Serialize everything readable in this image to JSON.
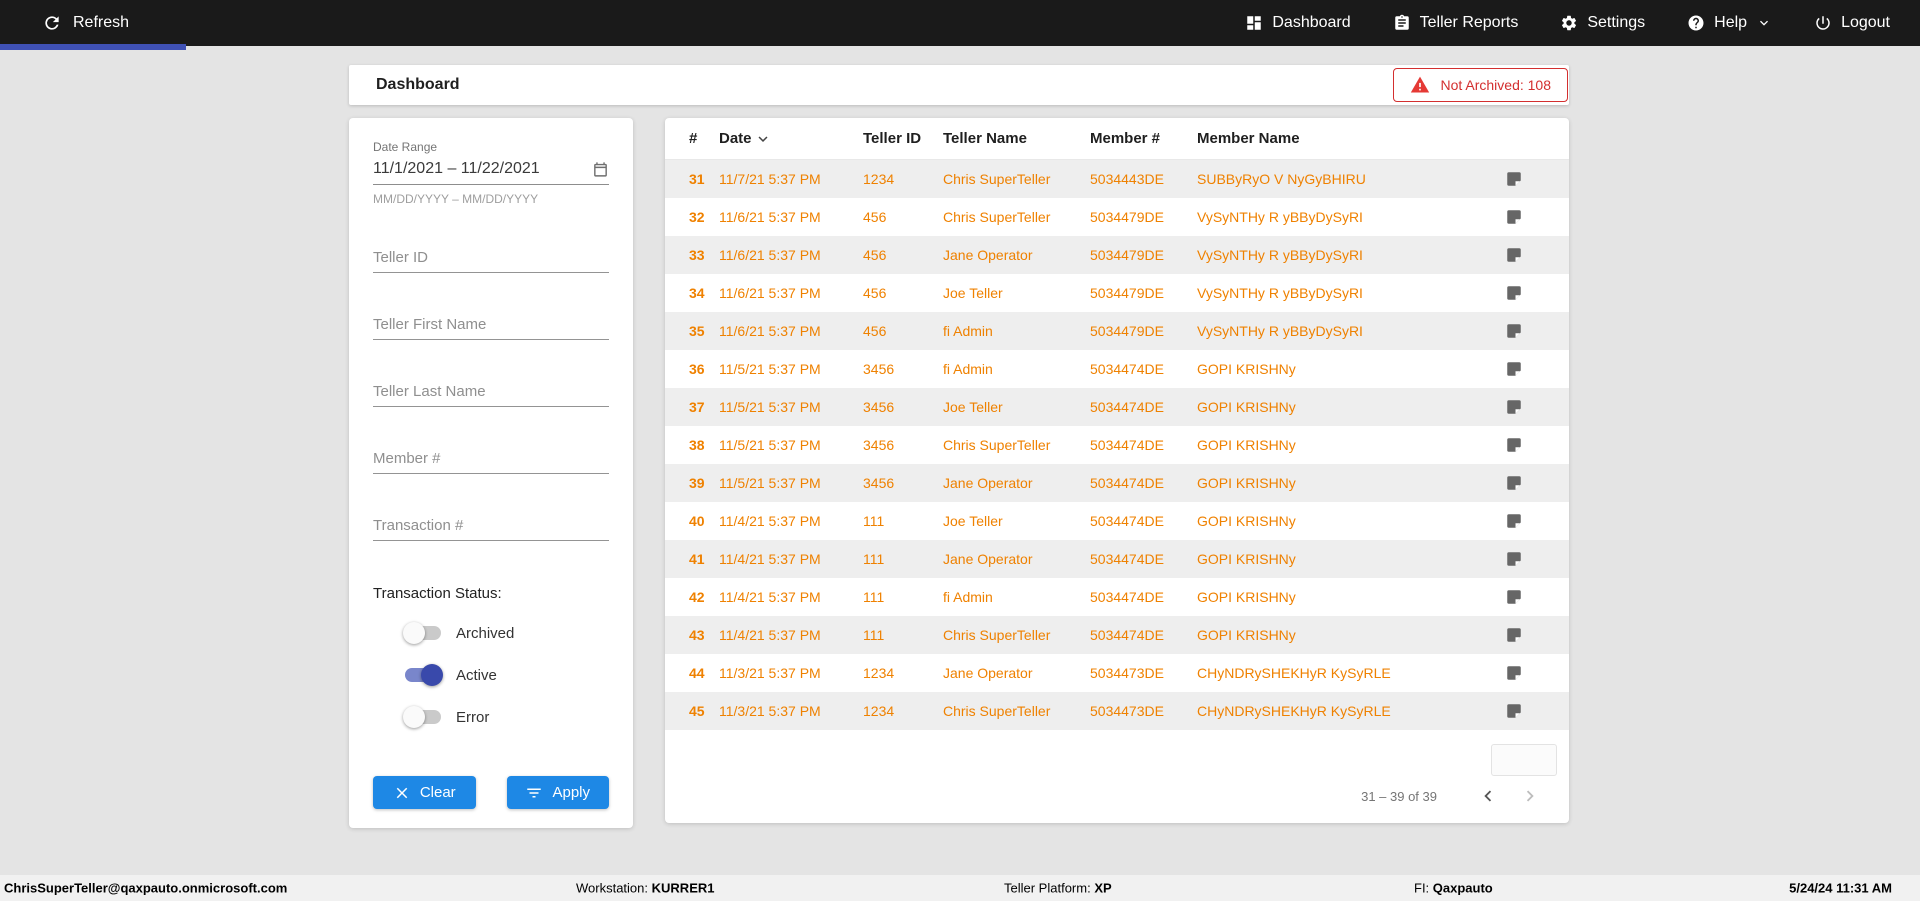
{
  "topbar": {
    "refresh_label": "Refresh",
    "nav": [
      {
        "label": "Dashboard",
        "icon": "dashboard-icon"
      },
      {
        "label": "Teller Reports",
        "icon": "clipboard-icon"
      },
      {
        "label": "Settings",
        "icon": "gear-icon"
      },
      {
        "label": "Help",
        "icon": "help-icon",
        "chevron": "chevron-down-icon"
      },
      {
        "label": "Logout",
        "icon": "power-icon"
      }
    ]
  },
  "header": {
    "title": "Dashboard",
    "not_archived": {
      "label": "Not Archived: 108",
      "icon": "warning-triangle-icon"
    }
  },
  "filters": {
    "date_range_label": "Date Range",
    "date_range_value": "11/1/2021 – 11/22/2021",
    "date_range_hint": "MM/DD/YYYY – MM/DD/YYYY",
    "date_icon": "calendar-icon",
    "fields": [
      {
        "placeholder": "Teller ID"
      },
      {
        "placeholder": "Teller First Name"
      },
      {
        "placeholder": "Teller Last Name"
      },
      {
        "placeholder": "Member #"
      },
      {
        "placeholder": "Transaction #"
      }
    ],
    "status_label": "Transaction Status:",
    "toggles": [
      {
        "label": "Archived",
        "on": false
      },
      {
        "label": "Active",
        "on": true
      },
      {
        "label": "Error",
        "on": false
      }
    ],
    "clear_label": "Clear",
    "clear_icon": "close-icon",
    "apply_label": "Apply",
    "apply_icon": "filter-icon"
  },
  "table": {
    "columns": [
      "#",
      "Date",
      "Teller ID",
      "Teller Name",
      "Member #",
      "Member Name"
    ],
    "sorted_by": "Date",
    "sort_direction": "desc",
    "row_note_icon": "note-icon",
    "rows": [
      {
        "num": "31",
        "date": "11/7/21 5:37 PM",
        "teller_id": "1234",
        "teller_name": "Chris SuperTeller",
        "member_num": "5034443DE",
        "member_name": "SUBByRyO V NyGyBHIRU"
      },
      {
        "num": "32",
        "date": "11/6/21 5:37 PM",
        "teller_id": "456",
        "teller_name": "Chris SuperTeller",
        "member_num": "5034479DE",
        "member_name": "VySyNTHy R yBByDySyRI"
      },
      {
        "num": "33",
        "date": "11/6/21 5:37 PM",
        "teller_id": "456",
        "teller_name": "Jane Operator",
        "member_num": "5034479DE",
        "member_name": "VySyNTHy R yBByDySyRI"
      },
      {
        "num": "34",
        "date": "11/6/21 5:37 PM",
        "teller_id": "456",
        "teller_name": "Joe Teller",
        "member_num": "5034479DE",
        "member_name": "VySyNTHy R yBByDySyRI"
      },
      {
        "num": "35",
        "date": "11/6/21 5:37 PM",
        "teller_id": "456",
        "teller_name": "fi Admin",
        "member_num": "5034479DE",
        "member_name": "VySyNTHy R yBByDySyRI"
      },
      {
        "num": "36",
        "date": "11/5/21 5:37 PM",
        "teller_id": "3456",
        "teller_name": "fi Admin",
        "member_num": "5034474DE",
        "member_name": "GOPI KRISHNy"
      },
      {
        "num": "37",
        "date": "11/5/21 5:37 PM",
        "teller_id": "3456",
        "teller_name": "Joe Teller",
        "member_num": "5034474DE",
        "member_name": "GOPI KRISHNy"
      },
      {
        "num": "38",
        "date": "11/5/21 5:37 PM",
        "teller_id": "3456",
        "teller_name": "Chris SuperTeller",
        "member_num": "5034474DE",
        "member_name": "GOPI KRISHNy"
      },
      {
        "num": "39",
        "date": "11/5/21 5:37 PM",
        "teller_id": "3456",
        "teller_name": "Jane Operator",
        "member_num": "5034474DE",
        "member_name": "GOPI KRISHNy"
      },
      {
        "num": "40",
        "date": "11/4/21 5:37 PM",
        "teller_id": "111",
        "teller_name": "Joe Teller",
        "member_num": "5034474DE",
        "member_name": "GOPI KRISHNy"
      },
      {
        "num": "41",
        "date": "11/4/21 5:37 PM",
        "teller_id": "111",
        "teller_name": "Jane Operator",
        "member_num": "5034474DE",
        "member_name": "GOPI KRISHNy"
      },
      {
        "num": "42",
        "date": "11/4/21 5:37 PM",
        "teller_id": "111",
        "teller_name": "fi Admin",
        "member_num": "5034474DE",
        "member_name": "GOPI KRISHNy"
      },
      {
        "num": "43",
        "date": "11/4/21 5:37 PM",
        "teller_id": "111",
        "teller_name": "Chris SuperTeller",
        "member_num": "5034474DE",
        "member_name": "GOPI KRISHNy"
      },
      {
        "num": "44",
        "date": "11/3/21 5:37 PM",
        "teller_id": "1234",
        "teller_name": "Jane Operator",
        "member_num": "5034473DE",
        "member_name": "CHyNDRySHEKHyR KySyRLE"
      },
      {
        "num": "45",
        "date": "11/3/21 5:37 PM",
        "teller_id": "1234",
        "teller_name": "Chris SuperTeller",
        "member_num": "5034473DE",
        "member_name": "CHyNDRySHEKHyR KySyRLE"
      }
    ],
    "pagination": {
      "range": "31 – 39 of 39",
      "prev_icon": "chevron-left-icon",
      "next_icon": "chevron-right-icon"
    }
  },
  "footer": {
    "user": "ChrisSuperTeller@qaxpauto.onmicrosoft.com",
    "workstation_label": "Workstation:",
    "workstation_value": "KURRER1",
    "platform_label": "Teller Platform:",
    "platform_value": "XP",
    "fi_label": "FI:",
    "fi_value": "Qaxpauto",
    "datetime": "5/24/24 11:31 AM"
  },
  "colors": {
    "topbar_bg": "#1a1a1a",
    "active_tab_indicator": "#3f51b5",
    "accent_blue": "#1e88e5",
    "table_text_orange": "#ef8100",
    "error_red": "#d32f2f",
    "toggle_on": "#3949ab",
    "row_alt_bg": "#eeeeee"
  }
}
